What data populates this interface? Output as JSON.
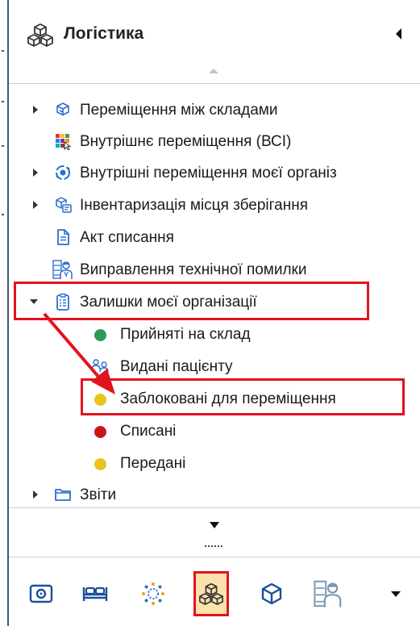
{
  "header": {
    "title": "Логістика",
    "logo_icon": "cubes-icon",
    "collapse_icon": "caret-left-icon"
  },
  "tree": {
    "items": [
      {
        "label": "Переміщення між складами",
        "icon": "cubes-transfer-icon",
        "expander": "collapsed"
      },
      {
        "label": "Внутрішнє переміщення (ВСІ)",
        "icon": "color-grid-icon",
        "expander": "none"
      },
      {
        "label": "Внутрішні переміщення моєї організ",
        "icon": "circular-arrows-icon",
        "expander": "collapsed"
      },
      {
        "label": "Інвентаризація місця зберігання",
        "icon": "inventory-icon",
        "expander": "collapsed"
      },
      {
        "label": "Акт списання",
        "icon": "document-icon",
        "expander": "none"
      },
      {
        "label": "Виправлення технічної помилки",
        "icon": "technician-icon",
        "expander": "none"
      },
      {
        "label": "Залишки моєї організації",
        "icon": "clipboard-icon",
        "expander": "expanded"
      }
    ],
    "children": [
      {
        "label": "Прийняті на склад",
        "icon": "status-dot",
        "color": "#2e9a58"
      },
      {
        "label": "Видані пацієнту",
        "icon": "patients-icon"
      },
      {
        "label": "Заблоковані для переміщення",
        "icon": "status-dot",
        "color": "#e8c51d"
      },
      {
        "label": "Списані",
        "icon": "status-dot",
        "color": "#c8151b"
      },
      {
        "label": "Передані",
        "icon": "status-dot",
        "color": "#e8c51d"
      }
    ],
    "last": {
      "label": "Звіти",
      "icon": "folder-icon",
      "expander": "collapsed"
    }
  },
  "toolbar": {
    "buttons": [
      {
        "icon": "folder-camera-icon",
        "active": false
      },
      {
        "icon": "bed-icon",
        "active": false
      },
      {
        "icon": "virus-icon",
        "active": false
      },
      {
        "icon": "cubes-icon",
        "active": true
      },
      {
        "icon": "cube-icon",
        "active": false
      },
      {
        "icon": "technician-icon",
        "active": false
      }
    ],
    "more_icon": "caret-down-icon"
  },
  "colors": {
    "accent": "#2a6fcf",
    "highlight": "#e3131e",
    "active_bg": "#fbe2ad"
  }
}
